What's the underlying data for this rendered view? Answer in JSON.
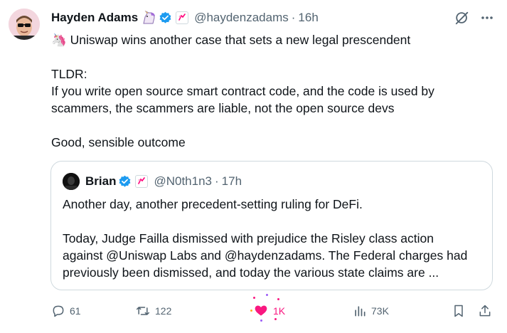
{
  "author": {
    "name": "Hayden Adams",
    "handle": "@haydenzadams",
    "time": "16h",
    "dot": "·"
  },
  "tweet": {
    "lines": [
      "🦄 Uniswap wins another case that sets a new legal prescendent",
      "",
      "TLDR:",
      "If you write open source smart contract code, and the code is used by",
      "scammers, the scammers are liable, not the open source devs",
      "",
      "Good, sensible outcome"
    ]
  },
  "quote": {
    "name": "Brian",
    "handle": "@N0th1n3",
    "time": "17h",
    "dot": "·",
    "lines": [
      "Another day, another precedent-setting ruling for DeFi.",
      "",
      "Today, Judge Failla dismissed with prejudice the Risley class action",
      "against @Uniswap Labs and @haydenzadams. The Federal charges had",
      "previously been dismissed, and today the various state claims are ..."
    ]
  },
  "actions": {
    "replies": "61",
    "reposts": "122",
    "likes": "1K",
    "views": "73K"
  },
  "colors": {
    "verified": "#1d9bf0",
    "like": "#f91880",
    "muted": "#536471",
    "border": "#cfd9de"
  },
  "icons": [
    "unicorn-emoji-icon",
    "verified-badge-icon",
    "affiliate-badge-icon",
    "grok-icon",
    "more-icon",
    "reply-icon",
    "repost-icon",
    "heart-icon",
    "views-icon",
    "bookmark-icon",
    "share-icon"
  ]
}
